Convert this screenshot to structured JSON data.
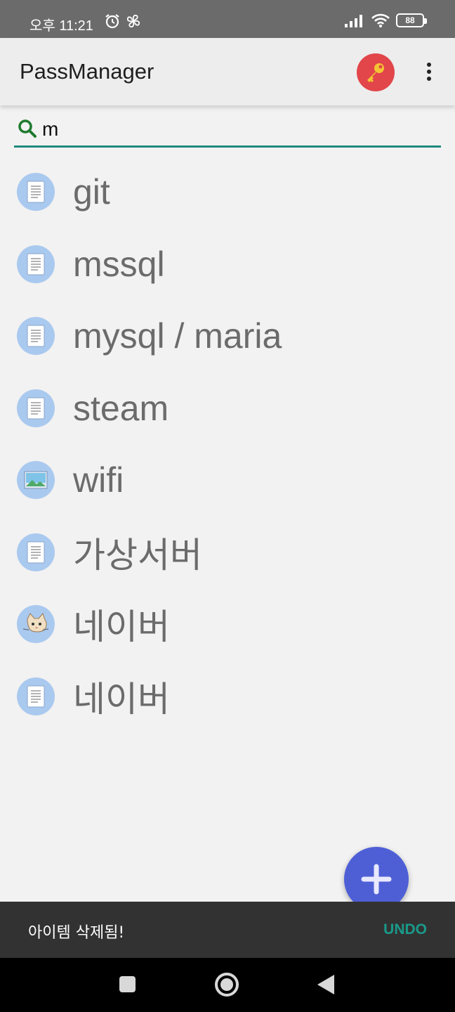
{
  "status_bar": {
    "time": "오후 11:21",
    "battery": "88",
    "icons": [
      "alarm-icon",
      "fan-icon",
      "signal-icon",
      "wifi-icon",
      "battery-icon"
    ]
  },
  "app_bar": {
    "title": "PassManager",
    "key_icon": "key-icon",
    "menu_icon": "more-vert-icon"
  },
  "search": {
    "value": "m",
    "icon": "search-icon"
  },
  "entries": [
    {
      "label": "git",
      "icon": "document-icon"
    },
    {
      "label": "mssql",
      "icon": "document-icon"
    },
    {
      "label": "mysql / maria",
      "icon": "document-icon"
    },
    {
      "label": "steam",
      "icon": "document-icon"
    },
    {
      "label": "wifi",
      "icon": "image-icon"
    },
    {
      "label": "가상서버",
      "icon": "document-icon"
    },
    {
      "label": "네이버",
      "icon": "cat-icon"
    },
    {
      "label": "네이버",
      "icon": "document-icon"
    }
  ],
  "fab": {
    "icon": "add-icon"
  },
  "snackbar": {
    "message": "아이템 삭제됨!",
    "action": "UNDO"
  },
  "nav_bar": {
    "icons": [
      "recents-icon",
      "home-icon",
      "back-icon"
    ]
  },
  "colors": {
    "accent": "#1e8a7e",
    "fab": "#4e5fd6",
    "key_button": "#e2454a",
    "entry_icon_bg": "#a9c9ef",
    "snackbar_bg": "#323232"
  }
}
